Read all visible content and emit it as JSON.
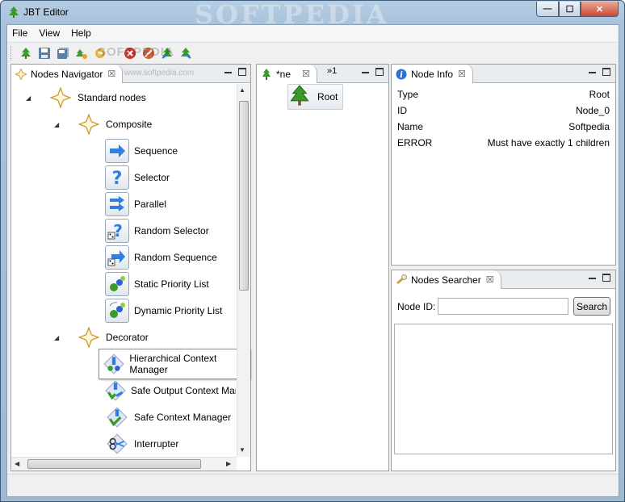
{
  "window": {
    "title": "JBT Editor",
    "watermark": "SOFTPEDIA",
    "controls": {
      "minimize": "—",
      "maximize": "☐",
      "close": "✕"
    }
  },
  "menubar": {
    "items": [
      "File",
      "View",
      "Help"
    ]
  },
  "toolbar": {
    "watermark": "SOFTPEDIA",
    "buttons": [
      "new-tree-icon",
      "save-icon",
      "save-all-icon",
      "tree-open-icon",
      "debug-icon",
      "stop-icon",
      "clear-icon",
      "tree-export-icon",
      "tree-import-icon"
    ]
  },
  "navigator": {
    "tab_label": "Nodes Navigator",
    "watermark": "www.softpedia.com",
    "tree": {
      "root": "Standard nodes",
      "composite": {
        "label": "Composite",
        "items": [
          "Sequence",
          "Selector",
          "Parallel",
          "Random Selector",
          "Random Sequence",
          "Static Priority List",
          "Dynamic Priority List"
        ]
      },
      "decorator": {
        "label": "Decorator",
        "items": [
          "Hierarchical Context Manager",
          "Safe Output Context Man",
          "Safe Context Manager",
          "Interrupter"
        ]
      }
    }
  },
  "editor": {
    "tab_label": "*ne",
    "overflow_label": "»1",
    "root_node_label": "Root"
  },
  "node_info": {
    "tab_label": "Node Info",
    "rows": [
      {
        "key": "Type",
        "value": "Root"
      },
      {
        "key": "ID",
        "value": "Node_0"
      },
      {
        "key": "Name",
        "value": "Softpedia"
      },
      {
        "key": "ERROR",
        "value": "Must have exactly 1 children"
      }
    ]
  },
  "searcher": {
    "tab_label": "Nodes Searcher",
    "field_label": "Node ID:",
    "field_value": "",
    "field_placeholder": "",
    "button_label": "Search"
  },
  "colors": {
    "title_gradient_top": "#b6cde3",
    "close_button": "#c94a33",
    "arrow_blue": "#2f7fe0",
    "tree_green": "#3a9a2a"
  }
}
